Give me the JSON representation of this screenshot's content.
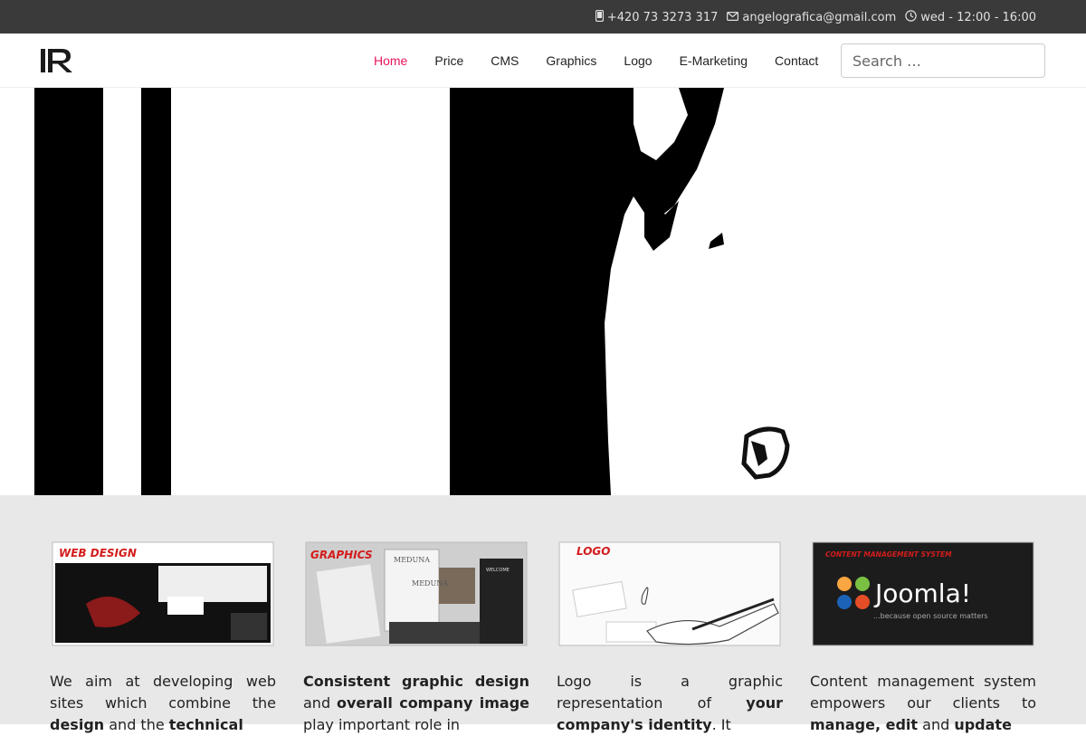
{
  "topbar": {
    "phone": "+420 73 3273 317",
    "email": "angelografica@gmail.com",
    "hours": "wed - 12:00 - 16:00"
  },
  "nav": {
    "items": [
      {
        "label": "Home",
        "active": true
      },
      {
        "label": "Price"
      },
      {
        "label": "CMS"
      },
      {
        "label": "Graphics"
      },
      {
        "label": "Logo"
      },
      {
        "label": "E-Marketing"
      },
      {
        "label": "Contact"
      }
    ],
    "search_placeholder": "Search …"
  },
  "features": [
    {
      "badge": "WEB DESIGN",
      "text": {
        "p1": "We aim at developing web sites which combine the ",
        "b1": "design",
        "p2": " and the ",
        "b2": "technical"
      }
    },
    {
      "badge": "GRAPHICS",
      "thumb_words": [
        "MEDUNA",
        "MEDUNA",
        "WELCOME"
      ],
      "text": {
        "b1": "Consistent graphic design",
        "p1": " and ",
        "b2": "overall company image",
        "p2": " play important role in"
      }
    },
    {
      "badge": "LOGO",
      "text": {
        "p1": "Logo is a graphic representation of ",
        "b1": "your company's identity",
        "p2": ". It"
      }
    },
    {
      "badge": "CONTENT MANAGEMENT SYSTEM",
      "thumb_brand": "Joomla!",
      "thumb_tagline": "...because open source matters",
      "text": {
        "p1": "Content management system empowers our clients to ",
        "b1": "manage, edit",
        "p2": " and ",
        "b2": "update"
      }
    }
  ]
}
